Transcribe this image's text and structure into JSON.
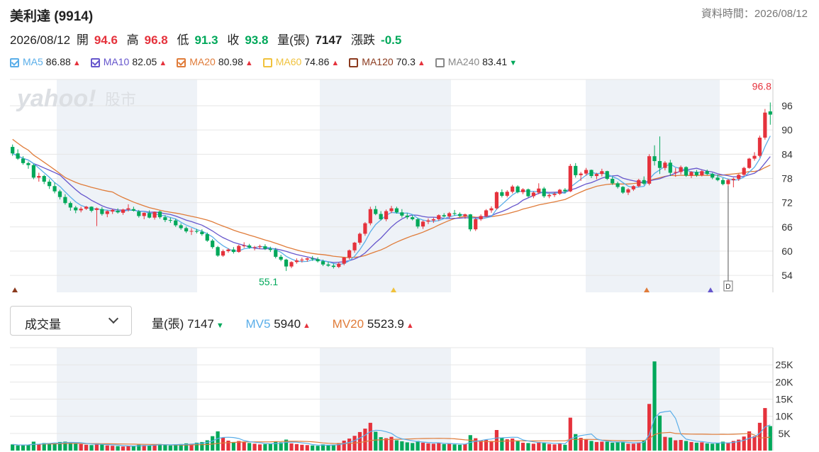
{
  "header": {
    "title": "美利達 (9914)",
    "data_time": "資料時間：2026/08/12"
  },
  "quote": {
    "date": "2026/08/12",
    "open_label": "開",
    "open": "94.6",
    "high_label": "高",
    "high": "96.8",
    "low_label": "低",
    "low": "91.3",
    "close_label": "收",
    "close": "93.8",
    "volume_label": "量(張)",
    "volume": "7147",
    "change_label": "漲跌",
    "change": "-0.5"
  },
  "ma_legend": [
    {
      "name": "MA5",
      "value": "86.88",
      "trend": "up",
      "color": "#5aaee9",
      "checked": true
    },
    {
      "name": "MA10",
      "value": "82.05",
      "trend": "up",
      "color": "#6656cc",
      "checked": true
    },
    {
      "name": "MA20",
      "value": "80.98",
      "trend": "up",
      "color": "#e07c3a",
      "checked": true
    },
    {
      "name": "MA60",
      "value": "74.86",
      "trend": "up",
      "color": "#f0c23d",
      "checked": false
    },
    {
      "name": "MA120",
      "value": "70.3",
      "trend": "up",
      "color": "#8b3a1e",
      "checked": false
    },
    {
      "name": "MA240",
      "value": "83.41",
      "trend": "down",
      "color": "#888888",
      "checked": false
    }
  ],
  "watermark": {
    "brand": "yahoo!",
    "suffix": "股市"
  },
  "volume_panel": {
    "select_label": "成交量",
    "vol_label": "量(張)",
    "vol_value": "7147",
    "vol_trend": "down",
    "mv5_label": "MV5",
    "mv5_value": "5940",
    "mv5_trend": "up",
    "mv20_label": "MV20",
    "mv20_value": "5523.9",
    "mv20_trend": "up"
  },
  "colors": {
    "up": "#e5323c",
    "down": "#00a85a",
    "ma5": "#5aaee9",
    "ma10": "#6656cc",
    "ma20": "#e07c3a",
    "band": "#eef2f7",
    "grid": "#e6e6e6"
  },
  "chart_data": {
    "type": "candlestick",
    "price_axis": {
      "ticks": [
        54,
        60,
        66,
        72,
        78,
        84,
        90,
        96
      ],
      "range": [
        49.8,
        102.5
      ]
    },
    "volume_axis": {
      "ticks": [
        "5K",
        "10K",
        "15K",
        "20K",
        "25K"
      ],
      "tick_values": [
        5000,
        10000,
        15000,
        20000,
        25000
      ],
      "max": 30000
    },
    "annotations": {
      "max_label": "96.8",
      "min_label": "55.1",
      "marker_label": "D"
    },
    "candles": [
      [
        85.8,
        86.4,
        83.6,
        84.2,
        1800
      ],
      [
        84.2,
        85.2,
        82.6,
        82.9,
        1500
      ],
      [
        82.9,
        83.5,
        81.4,
        81.8,
        1600
      ],
      [
        81.8,
        82.2,
        80.4,
        81.3,
        1700
      ],
      [
        81.3,
        81.6,
        77.8,
        78.2,
        2600
      ],
      [
        78.2,
        79.4,
        77.2,
        78.6,
        1900
      ],
      [
        78.6,
        78.9,
        76.6,
        77.2,
        2200
      ],
      [
        77.2,
        77.8,
        75.4,
        76.1,
        2100
      ],
      [
        76.1,
        77.0,
        74.3,
        74.8,
        2300
      ],
      [
        74.8,
        75.2,
        72.8,
        73.4,
        2500
      ],
      [
        73.4,
        74.1,
        71.5,
        71.9,
        2600
      ],
      [
        71.9,
        72.3,
        70.0,
        70.8,
        2400
      ],
      [
        70.8,
        71.2,
        69.4,
        70.1,
        2000
      ],
      [
        70.1,
        71.0,
        69.6,
        70.5,
        1900
      ],
      [
        70.5,
        71.2,
        70.2,
        71.0,
        1700
      ],
      [
        71.0,
        71.1,
        69.6,
        70.0,
        1600
      ],
      [
        70.2,
        70.8,
        66.2,
        70.6,
        2100
      ],
      [
        70.4,
        70.9,
        68.8,
        69.2,
        1800
      ],
      [
        69.2,
        70.1,
        68.4,
        69.9,
        1500
      ],
      [
        69.8,
        70.4,
        69.2,
        70.2,
        1400
      ],
      [
        70.0,
        70.6,
        69.3,
        69.6,
        1300
      ],
      [
        69.5,
        70.5,
        69.0,
        70.3,
        1200
      ],
      [
        70.3,
        71.6,
        69.8,
        70.6,
        1400
      ],
      [
        70.4,
        71.0,
        69.8,
        70.0,
        1300
      ],
      [
        69.8,
        70.2,
        68.3,
        68.7,
        1700
      ],
      [
        68.7,
        69.6,
        67.9,
        69.5,
        1600
      ],
      [
        69.4,
        70.1,
        68.1,
        68.3,
        1500
      ],
      [
        68.3,
        69.8,
        67.8,
        69.7,
        1800
      ],
      [
        69.8,
        70.0,
        68.0,
        68.4,
        1900
      ],
      [
        68.4,
        68.9,
        67.2,
        67.7,
        1700
      ],
      [
        67.7,
        68.3,
        67.0,
        67.6,
        1500
      ],
      [
        67.6,
        68.0,
        66.0,
        66.4,
        1800
      ],
      [
        66.4,
        66.9,
        65.3,
        65.7,
        1900
      ],
      [
        65.7,
        66.1,
        64.5,
        64.9,
        2100
      ],
      [
        64.9,
        65.7,
        64.0,
        65.0,
        2000
      ],
      [
        65.0,
        65.5,
        64.4,
        64.8,
        2300
      ],
      [
        64.8,
        65.4,
        63.8,
        64.2,
        2500
      ],
      [
        64.2,
        64.6,
        62.3,
        62.6,
        3000
      ],
      [
        62.6,
        63.0,
        60.6,
        61.0,
        4200
      ],
      [
        61.0,
        61.3,
        58.6,
        58.9,
        5600
      ],
      [
        58.9,
        60.4,
        58.6,
        60.0,
        3800
      ],
      [
        60.0,
        60.7,
        59.6,
        60.4,
        2900
      ],
      [
        60.4,
        61.0,
        59.4,
        59.8,
        2500
      ],
      [
        59.8,
        61.6,
        59.6,
        61.3,
        2800
      ],
      [
        61.3,
        62.2,
        60.8,
        61.4,
        2600
      ],
      [
        61.4,
        61.8,
        60.6,
        60.9,
        2200
      ],
      [
        60.9,
        61.3,
        60.2,
        61.0,
        2000
      ],
      [
        61.0,
        61.6,
        60.6,
        61.2,
        1800
      ],
      [
        61.2,
        61.7,
        60.3,
        60.6,
        1900
      ],
      [
        60.6,
        61.1,
        59.8,
        60.3,
        2000
      ],
      [
        60.3,
        60.8,
        58.2,
        58.6,
        2600
      ],
      [
        58.6,
        59.1,
        57.5,
        57.9,
        2400
      ],
      [
        57.9,
        58.1,
        55.1,
        56.2,
        3200
      ],
      [
        56.2,
        57.5,
        55.8,
        57.3,
        2100
      ],
      [
        57.3,
        58.2,
        56.9,
        57.7,
        1900
      ],
      [
        57.7,
        58.4,
        57.2,
        57.9,
        1700
      ],
      [
        57.9,
        58.4,
        57.4,
        58.2,
        1600
      ],
      [
        58.2,
        58.8,
        57.6,
        58.0,
        1500
      ],
      [
        58.0,
        58.5,
        57.2,
        57.5,
        1400
      ],
      [
        57.5,
        57.9,
        56.3,
        56.7,
        1800
      ],
      [
        56.7,
        57.4,
        56.1,
        56.4,
        1600
      ],
      [
        56.4,
        56.9,
        55.7,
        56.1,
        1700
      ],
      [
        56.1,
        57.2,
        55.8,
        56.9,
        2200
      ],
      [
        56.9,
        58.6,
        56.5,
        58.4,
        2900
      ],
      [
        58.4,
        60.4,
        57.9,
        60.2,
        3500
      ],
      [
        60.2,
        62.3,
        59.6,
        62.1,
        4300
      ],
      [
        62.1,
        64.6,
        61.6,
        64.3,
        5400
      ],
      [
        64.3,
        67.2,
        63.8,
        66.9,
        6400
      ],
      [
        66.9,
        71.0,
        66.4,
        70.4,
        8100
      ],
      [
        70.4,
        71.2,
        68.9,
        69.2,
        5500
      ],
      [
        69.2,
        69.9,
        67.6,
        67.9,
        3900
      ],
      [
        67.9,
        70.3,
        67.4,
        69.9,
        3600
      ],
      [
        69.9,
        71.2,
        69.4,
        70.6,
        4000
      ],
      [
        70.6,
        71.0,
        69.3,
        69.6,
        3000
      ],
      [
        69.6,
        70.4,
        68.3,
        68.8,
        2700
      ],
      [
        68.8,
        69.4,
        67.9,
        68.4,
        2400
      ],
      [
        68.4,
        68.9,
        67.6,
        67.9,
        2200
      ],
      [
        67.9,
        68.2,
        65.6,
        66.1,
        2800
      ],
      [
        66.1,
        67.6,
        65.5,
        67.3,
        2300
      ],
      [
        67.3,
        68.1,
        66.7,
        67.6,
        2100
      ],
      [
        67.6,
        68.3,
        67.0,
        67.9,
        2000
      ],
      [
        67.9,
        69.1,
        67.5,
        68.9,
        2200
      ],
      [
        68.9,
        69.4,
        68.3,
        68.6,
        1900
      ],
      [
        68.6,
        69.7,
        68.1,
        69.4,
        2000
      ],
      [
        69.4,
        70.2,
        68.8,
        69.2,
        1800
      ],
      [
        69.2,
        69.6,
        68.4,
        68.7,
        1700
      ],
      [
        68.7,
        69.3,
        68.0,
        69.1,
        1900
      ],
      [
        69.1,
        69.2,
        64.9,
        65.4,
        4500
      ],
      [
        65.4,
        68.2,
        65.0,
        67.9,
        3600
      ],
      [
        67.9,
        69.1,
        67.5,
        68.7,
        2900
      ],
      [
        68.7,
        70.4,
        68.4,
        70.1,
        3100
      ],
      [
        70.1,
        71.1,
        69.5,
        70.6,
        2800
      ],
      [
        70.6,
        74.8,
        70.3,
        74.6,
        6000
      ],
      [
        74.6,
        75.3,
        73.3,
        73.7,
        3800
      ],
      [
        73.7,
        75.1,
        73.3,
        74.7,
        3300
      ],
      [
        74.7,
        76.4,
        74.3,
        76.0,
        3500
      ],
      [
        76.0,
        76.3,
        74.3,
        74.6,
        2700
      ],
      [
        74.6,
        75.6,
        74.1,
        75.3,
        2300
      ],
      [
        75.3,
        75.5,
        73.3,
        73.6,
        2200
      ],
      [
        73.6,
        74.8,
        73.1,
        74.5,
        2000
      ],
      [
        74.5,
        76.8,
        74.1,
        75.5,
        2500
      ],
      [
        75.5,
        75.9,
        73.2,
        73.6,
        2400
      ],
      [
        73.6,
        74.3,
        73.1,
        73.9,
        1900
      ],
      [
        73.9,
        74.6,
        73.4,
        74.2,
        1800
      ],
      [
        74.2,
        75.4,
        73.9,
        75.2,
        2000
      ],
      [
        75.2,
        75.6,
        74.4,
        74.8,
        1700
      ],
      [
        74.8,
        81.6,
        74.6,
        81.1,
        9600
      ],
      [
        81.1,
        81.8,
        78.2,
        78.8,
        4800
      ],
      [
        78.8,
        79.6,
        77.4,
        79.2,
        3700
      ],
      [
        79.2,
        80.6,
        78.7,
        80.1,
        3300
      ],
      [
        80.1,
        80.2,
        78.1,
        78.6,
        2800
      ],
      [
        78.6,
        79.4,
        77.8,
        79.1,
        2500
      ],
      [
        79.1,
        80.4,
        78.5,
        79.8,
        2600
      ],
      [
        79.8,
        79.9,
        77.6,
        77.9,
        2600
      ],
      [
        77.9,
        78.4,
        76.4,
        76.8,
        2300
      ],
      [
        76.8,
        77.2,
        75.5,
        75.9,
        2400
      ],
      [
        75.9,
        76.1,
        74.2,
        74.5,
        2600
      ],
      [
        74.5,
        75.6,
        73.9,
        75.3,
        2000
      ],
      [
        75.3,
        76.3,
        74.9,
        76.1,
        2000
      ],
      [
        76.1,
        77.9,
        75.8,
        77.6,
        2400
      ],
      [
        77.6,
        78.5,
        76.3,
        76.7,
        3000
      ],
      [
        76.7,
        84.0,
        76.3,
        83.5,
        13600
      ],
      [
        83.5,
        86.2,
        81.2,
        82.3,
        26000
      ],
      [
        82.3,
        88.4,
        79.1,
        80.6,
        10200
      ],
      [
        80.6,
        82.3,
        80.0,
        81.9,
        4000
      ],
      [
        81.9,
        82.6,
        78.6,
        79.4,
        3800
      ],
      [
        79.4,
        80.6,
        78.4,
        79.6,
        3000
      ],
      [
        79.6,
        81.2,
        79.0,
        80.8,
        3100
      ],
      [
        80.8,
        81.0,
        78.4,
        78.7,
        2800
      ],
      [
        78.7,
        79.8,
        78.1,
        79.6,
        2500
      ],
      [
        79.6,
        80.1,
        78.4,
        78.8,
        2300
      ],
      [
        78.8,
        80.1,
        78.5,
        79.8,
        2400
      ],
      [
        79.8,
        80.2,
        78.8,
        79.1,
        2100
      ],
      [
        79.1,
        79.4,
        77.8,
        78.2,
        2000
      ],
      [
        78.2,
        78.9,
        77.3,
        77.6,
        2200
      ],
      [
        77.6,
        78.1,
        76.3,
        76.6,
        2600
      ],
      [
        76.6,
        77.9,
        76.2,
        77.6,
        2300
      ],
      [
        77.6,
        78.2,
        75.8,
        77.9,
        2800
      ],
      [
        77.9,
        79.1,
        77.4,
        78.9,
        3200
      ],
      [
        78.9,
        80.9,
        78.6,
        80.6,
        4100
      ],
      [
        80.6,
        83.1,
        80.4,
        82.9,
        5600
      ],
      [
        82.9,
        84.5,
        82.4,
        83.6,
        4200
      ],
      [
        83.6,
        88.6,
        83.2,
        88.1,
        8100
      ],
      [
        88.1,
        95.2,
        87.6,
        94.3,
        12400
      ],
      [
        94.6,
        96.8,
        91.3,
        93.8,
        7147
      ]
    ]
  }
}
